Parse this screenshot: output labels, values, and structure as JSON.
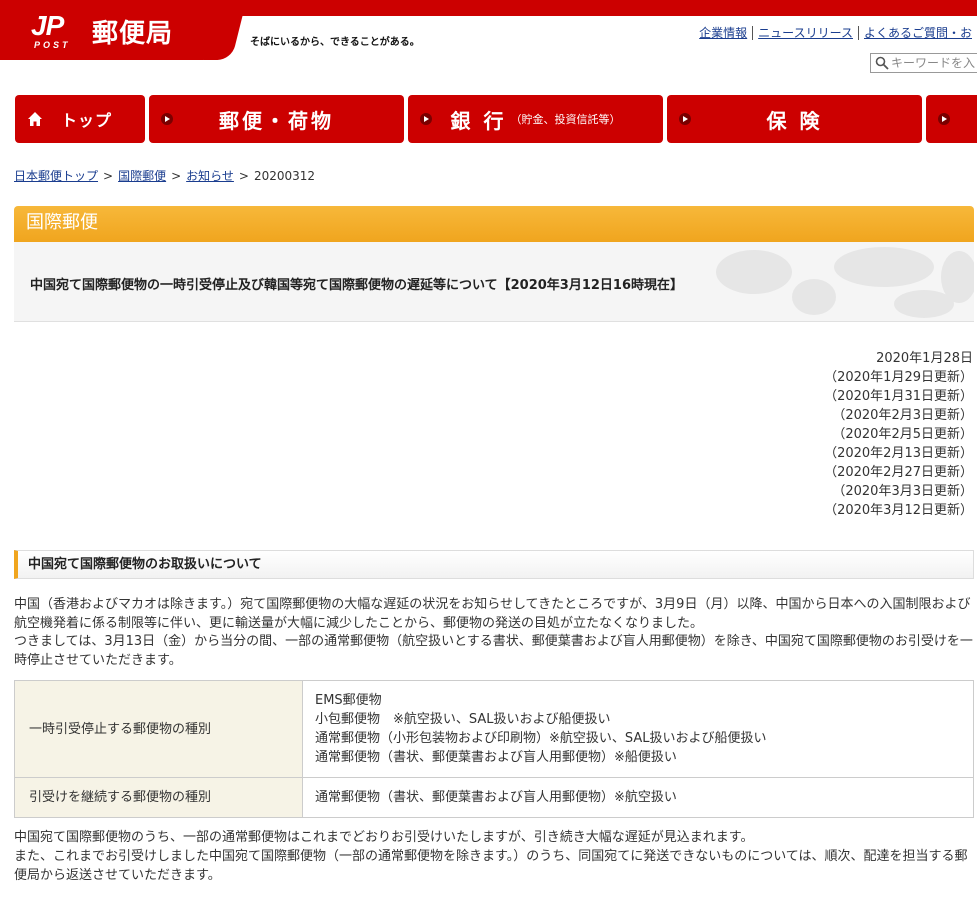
{
  "header": {
    "logo_mark": "JP",
    "logo_post": "POST",
    "logo_text": "郵便局",
    "tagline": "そばにいるから、できることがある。",
    "util_links": [
      "企業情報",
      "ニュースリリース",
      "よくあるご質問・お"
    ],
    "search_placeholder": "キーワードを入"
  },
  "nav": {
    "top": "トップ",
    "items": [
      {
        "label": "郵便・荷物",
        "sub": ""
      },
      {
        "label": "銀 行",
        "sub": "（貯金、投資信託等）"
      },
      {
        "label": "保 険",
        "sub": ""
      },
      {
        "label": "",
        "sub": ""
      }
    ]
  },
  "breadcrumb": {
    "links": [
      "日本郵便トップ",
      "国際郵便",
      "お知らせ"
    ],
    "current": "20200312",
    "separator": ">"
  },
  "category": "国際郵便",
  "page_title": "中国宛て国際郵便物の一時引受停止及び韓国等宛て国際郵便物の遅延等について【2020年3月12日16時現在】",
  "dates": [
    "2020年1月28日",
    "（2020年1月29日更新）",
    "（2020年1月31日更新）",
    "（2020年2月3日更新）",
    "（2020年2月5日更新）",
    "（2020年2月13日更新）",
    "（2020年2月27日更新）",
    "（2020年3月3日更新）",
    "（2020年3月12日更新）"
  ],
  "section": {
    "heading": "中国宛て国際郵便物のお取扱いについて",
    "para1": "中国（香港およびマカオは除きます。）宛て国際郵便物の大幅な遅延の状況をお知らせしてきたところですが、3月9日（月）以降、中国から日本への入国制限および航空機発着に係る制限等に伴い、更に輸送量が大幅に減少したことから、郵便物の発送の目処が立たなくなりました。",
    "para2": "つきましては、3月13日（金）から当分の間、一部の通常郵便物（航空扱いとする書状、郵便葉書および盲人用郵便物）を除き、中国宛て国際郵便物のお引受けを一時停止させていただきます。",
    "table": [
      {
        "label": "一時引受停止する郵便物の種別",
        "values": [
          "EMS郵便物",
          "小包郵便物　※航空扱い、SAL扱いおよび船便扱い",
          "通常郵便物（小形包装物および印刷物）※航空扱い、SAL扱いおよび船便扱い",
          "通常郵便物（書状、郵便葉書および盲人用郵便物）※船便扱い"
        ]
      },
      {
        "label": "引受けを継続する郵便物の種別",
        "values": [
          "通常郵便物（書状、郵便葉書および盲人用郵便物）※航空扱い"
        ]
      }
    ],
    "para3": "中国宛て国際郵便物のうち、一部の通常郵便物はこれまでどおりお引受けいたしますが、引き続き大幅な遅延が見込まれます。",
    "para4": "また、これまでお引受けしました中国宛て国際郵便物（一部の通常郵便物を除きます。）のうち、同国宛てに発送できないものについては、順次、配達を担当する郵便局から返送させていただきます。"
  },
  "colors": {
    "brand_red": "#cc0000",
    "accent_orange": "#f0a51e",
    "link_blue": "#1a3d8f"
  }
}
